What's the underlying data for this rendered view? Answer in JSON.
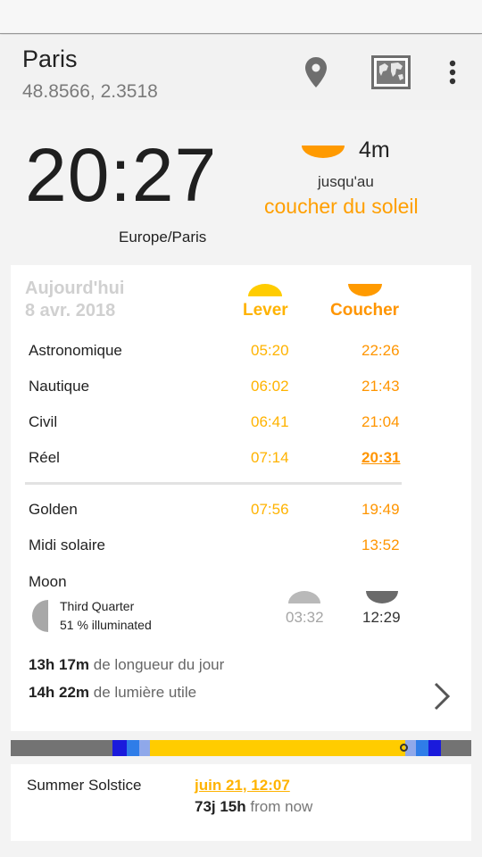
{
  "location": {
    "name": "Paris",
    "coords": "48.8566, 2.3518"
  },
  "toolbar": {
    "icons": [
      "location-pin-icon",
      "world-map-icon",
      "more-vert-icon"
    ]
  },
  "clock": {
    "time": "20:27",
    "timezone": "Europe/Paris"
  },
  "next_event": {
    "countdown": "4m",
    "until": "jusqu'au",
    "event": "coucher du soleil"
  },
  "table": {
    "day_label": "Aujourd'hui",
    "date": "8 avr. 2018",
    "rise_header": "Lever",
    "set_header": "Coucher",
    "rows": [
      {
        "label": "Astronomique",
        "rise": "05:20",
        "set": "22:26"
      },
      {
        "label": "Nautique",
        "rise": "06:02",
        "set": "21:43"
      },
      {
        "label": "Civil",
        "rise": "06:41",
        "set": "21:04"
      },
      {
        "label": "Réel",
        "rise": "07:14",
        "set": "20:31"
      },
      {
        "label": "Golden",
        "rise": "07:56",
        "set": "19:49"
      },
      {
        "label": "Midi solaire",
        "rise": "",
        "set": "13:52"
      }
    ]
  },
  "moon": {
    "title": "Moon",
    "phase": "Third Quarter",
    "illumination": "51 % illuminated",
    "rise": "03:32",
    "set": "12:29"
  },
  "stats": {
    "day_length_value": "13h 17m",
    "day_length_label": "de longueur du jour",
    "light_value": "14h 22m",
    "light_label": "de lumière utile"
  },
  "day_bar": {
    "colors": {
      "night": "#737373",
      "astro": "#1a1adc",
      "nautical": "#2f7de8",
      "civil": "#8fa8ea",
      "day": "#ffcc00"
    }
  },
  "season": {
    "name": "Summer Solstice",
    "date": "juin 21, 12:07",
    "remaining": "73j 15h",
    "remaining_suffix": "from now"
  },
  "colors": {
    "rise": "#ffb300",
    "set": "#ff9500",
    "accent": "#ff9f00"
  }
}
